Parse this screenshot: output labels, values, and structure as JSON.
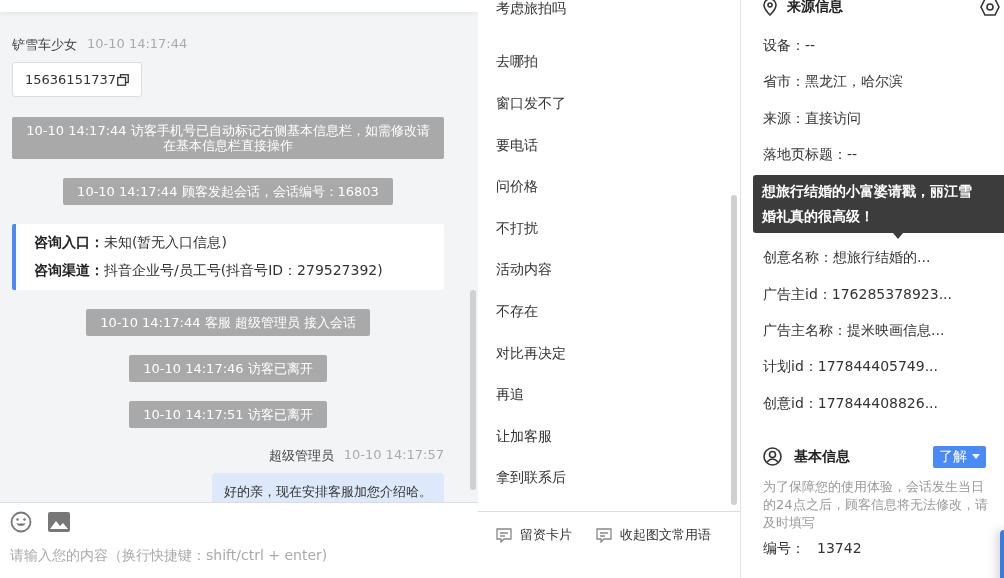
{
  "chat": {
    "messages": [
      {
        "kind": "visitor",
        "name": "铲雪车少女",
        "time": "10-10 14:17:44",
        "text": "15636151737"
      },
      {
        "kind": "system",
        "text": "10-10 14:17:44 访客手机号已自动标记右侧基本信息栏，如需修改请在基本信息栏直接操作"
      },
      {
        "kind": "system",
        "text": "10-10 14:17:44 顾客发起会话，会话编号：16803"
      },
      {
        "kind": "info",
        "rows": [
          {
            "label": "咨询入口：",
            "value": "未知(暂无入口信息)"
          },
          {
            "label": "咨询渠道：",
            "value": "抖音企业号/员工号(抖音号ID：279527392)"
          }
        ]
      },
      {
        "kind": "system",
        "text": "10-10 14:17:44 客服 超级管理员 接入会话"
      },
      {
        "kind": "system",
        "text": "10-10 14:17:46 访客已离开"
      },
      {
        "kind": "system",
        "text": "10-10 14:17:51 访客已离开"
      },
      {
        "kind": "agent",
        "name": "超级管理员",
        "time": "10-10 14:17:57",
        "text": "好的亲，现在安排客服加您介绍哈。"
      }
    ]
  },
  "input": {
    "placeholder": "请输入您的内容（换行快捷键：shift/ctrl + enter)"
  },
  "phrases": [
    "考虑旅拍吗",
    "去哪拍",
    "窗口发不了",
    "要电话",
    "问价格",
    "不打扰",
    "活动内容",
    "不存在",
    "对比再决定",
    "再追",
    "让加客服",
    "拿到联系后"
  ],
  "phrase_actions": [
    "留资卡片",
    "收起图文常用语"
  ],
  "source": {
    "title": "来源信息",
    "rows_above": [
      "设备：--",
      "省市：黑龙江，哈尔滨",
      "来源：直接访问",
      "落地页标题：--"
    ],
    "tooltip": [
      "想旅行结婚的小富婆请戳，丽江雪",
      "婚礼真的很高级！"
    ],
    "rows_below": [
      "创意名称：想旅行结婚的...",
      "广告主id：176285378923...",
      "广告主名称：提米映画信息...",
      "计划id：177844405749...",
      "创意id：177844408826..."
    ]
  },
  "basic": {
    "title": "基本信息",
    "button": "了解",
    "note": "为了保障您的使用体验，会话发生当日的24点之后，顾客信息将无法修改，请及时填写",
    "field": {
      "label": "编号：",
      "value": "13742"
    }
  }
}
